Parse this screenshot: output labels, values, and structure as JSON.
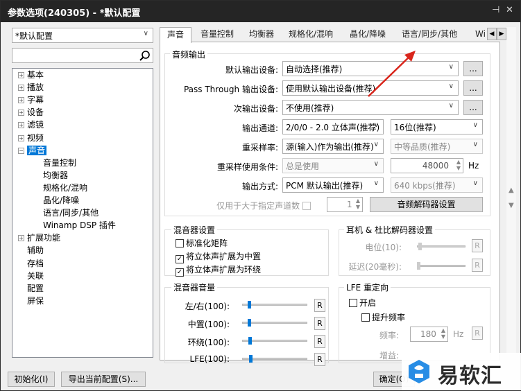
{
  "window": {
    "title": "参数选项(240305) - *默认配置",
    "pin_icon": "pin-icon",
    "close_icon": "close-icon"
  },
  "left": {
    "profile_combo": "*默认配置",
    "search_placeholder": "",
    "tree": [
      {
        "label": "基本",
        "expander": "+",
        "level": 0
      },
      {
        "label": "播放",
        "expander": "+",
        "level": 0
      },
      {
        "label": "字幕",
        "expander": "+",
        "level": 0
      },
      {
        "label": "设备",
        "expander": "+",
        "level": 0
      },
      {
        "label": "滤镜",
        "expander": "+",
        "level": 0
      },
      {
        "label": "视频",
        "expander": "+",
        "level": 0
      },
      {
        "label": "声音",
        "expander": "−",
        "level": 0,
        "selected": true
      },
      {
        "label": "音量控制",
        "level": 1
      },
      {
        "label": "均衡器",
        "level": 1
      },
      {
        "label": "规格化/混响",
        "level": 1
      },
      {
        "label": "晶化/降噪",
        "level": 1
      },
      {
        "label": "语言/同步/其他",
        "level": 1
      },
      {
        "label": "Winamp DSP 插件",
        "level": 1
      },
      {
        "label": "扩展功能",
        "expander": "+",
        "level": 0
      },
      {
        "label": "辅助",
        "level": 0
      },
      {
        "label": "存档",
        "level": 0
      },
      {
        "label": "关联",
        "level": 0
      },
      {
        "label": "配置",
        "level": 0
      },
      {
        "label": "屏保",
        "level": 0
      }
    ]
  },
  "tabs": [
    "声音",
    "音量控制",
    "均衡器",
    "规格化/混响",
    "晶化/降噪",
    "语言/同步/其他",
    "Wi"
  ],
  "audio_output": {
    "title": "音频输出",
    "default_device_label": "默认输出设备:",
    "default_device": "自动选择(推荐)",
    "passthrough_label": "Pass Through 输出设备:",
    "passthrough": "使用默认输出设备(推荐)",
    "secondary_label": "次输出设备:",
    "secondary": "不使用(推荐)",
    "more_btn": "...",
    "channel_label": "输出通道:",
    "channel": "2/0/0 - 2.0 立体声(推荐)",
    "bits": "16位(推荐)",
    "resample_label": "重采样率:",
    "resample": "源(输入)作为输出(推荐)",
    "quality": "中等品质(推荐)",
    "resample_cond_label": "重采样使用条件:",
    "resample_cond": "总是使用",
    "rate": "48000",
    "rate_unit": "Hz",
    "output_mode_label": "输出方式:",
    "output_mode": "PCM 默认输出(推荐)",
    "bitrate": "640 kbps(推荐)",
    "channels_only_label": "仅用于大于指定声道数",
    "channels_only_value": "1",
    "decoder_btn": "音频解码器设置"
  },
  "mixer": {
    "title": "混音器设置",
    "normalize": "标准化矩阵",
    "stereo_center": "将立体声扩展为中置",
    "stereo_surround": "将立体声扩展为环绕",
    "normalize_checked": false,
    "center_checked": true,
    "surround_checked": true
  },
  "headphone": {
    "title": "耳机 & 杜比解码器设置",
    "level_label": "电位(10):",
    "delay_label": "延迟(20毫秒):",
    "r": "R"
  },
  "mixer_volume": {
    "title": "混音器音量",
    "rows": [
      {
        "label": "左/右(100):"
      },
      {
        "label": "中置(100):"
      },
      {
        "label": "环绕(100):"
      },
      {
        "label": "LFE(100):"
      }
    ],
    "r": "R"
  },
  "lfe": {
    "title": "LFE 重定向",
    "enable": "开启",
    "boost": "提升频率",
    "freq_label": "频率:",
    "freq_value": "180",
    "freq_unit": "Hz",
    "gain_label": "增益:"
  },
  "bottom": {
    "reset_btn": "初始化(I)",
    "export_btn": "导出当前配置(S)...",
    "ok_btn": "确定(O)"
  },
  "watermark": {
    "text": "易软汇"
  }
}
